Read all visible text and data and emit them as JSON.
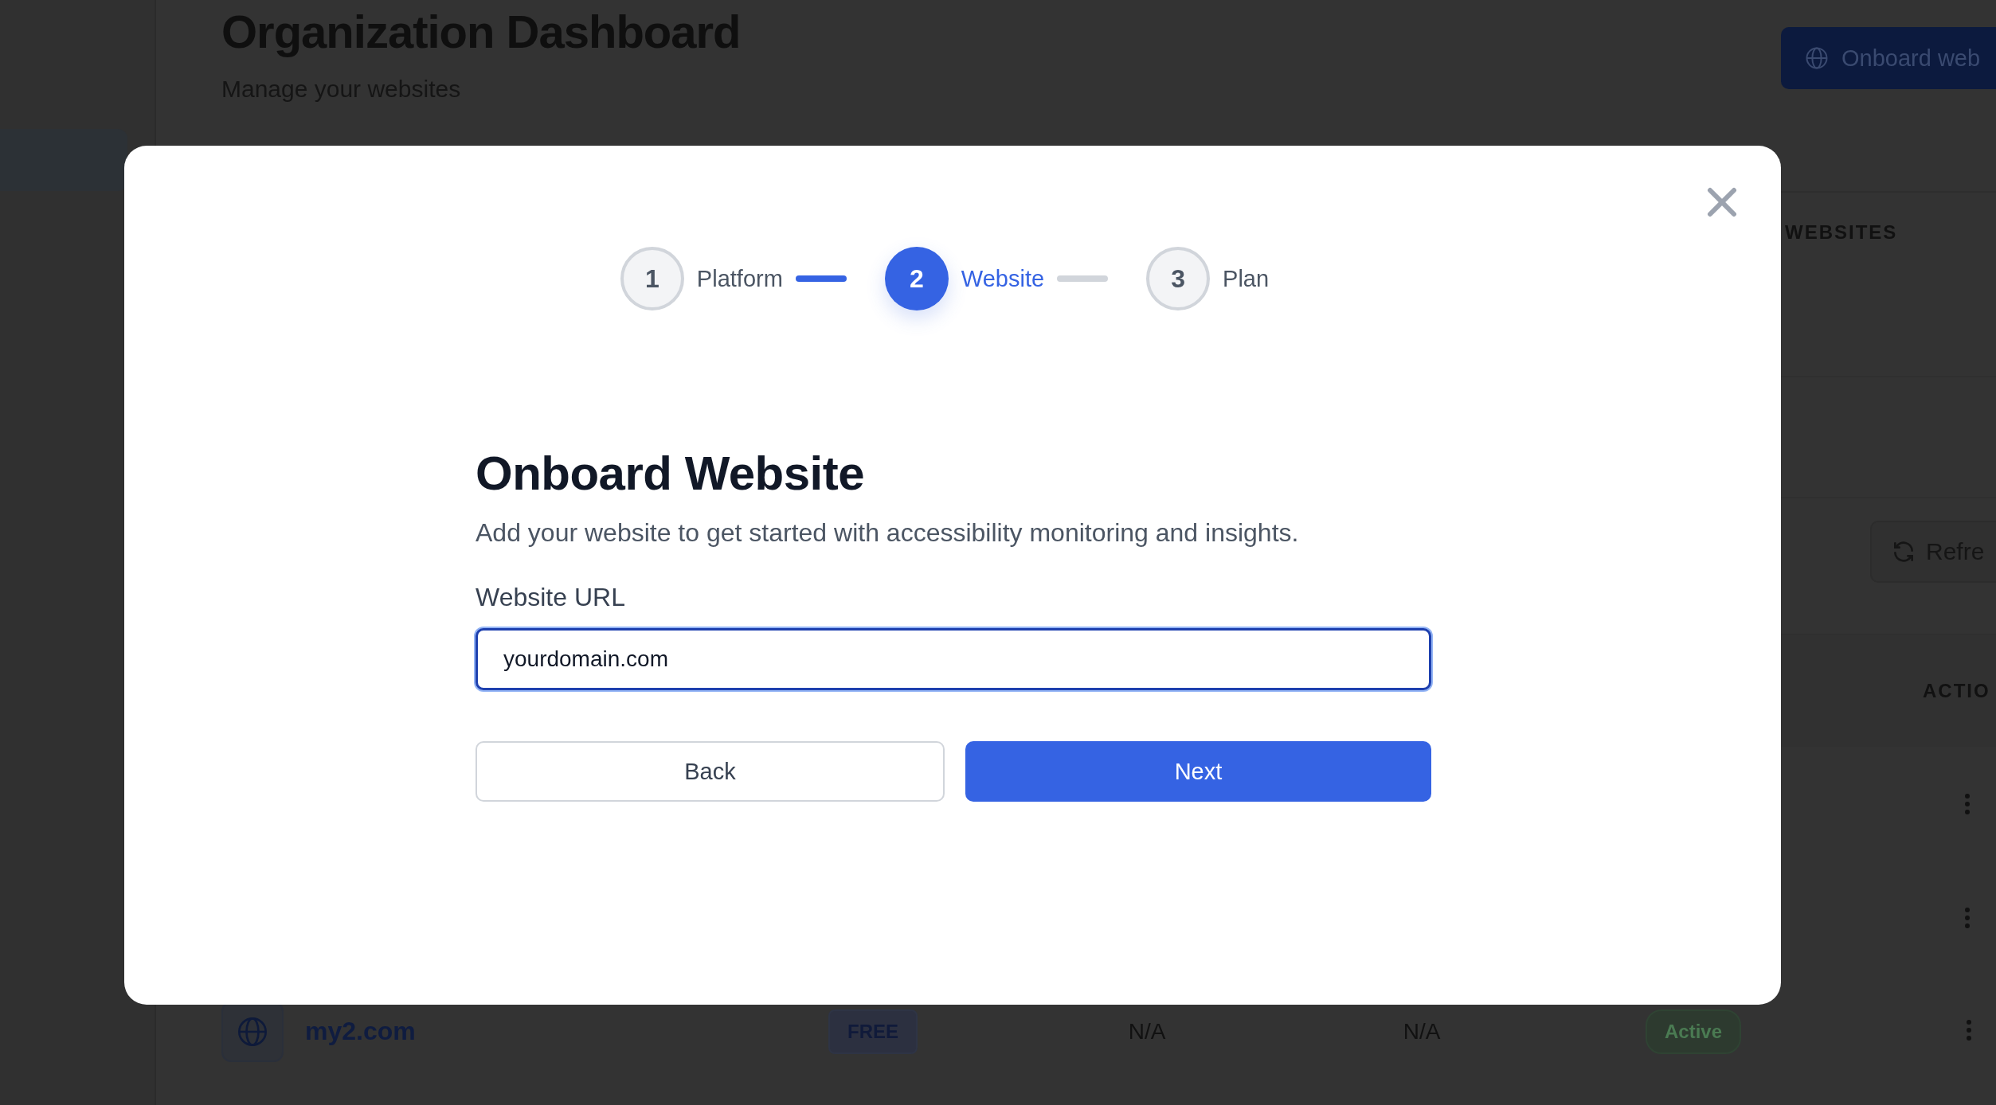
{
  "page": {
    "title": "Organization Dashboard",
    "subtitle": "Manage your websites",
    "onboard_button": "Onboard web",
    "stat_label": "WEBSITES",
    "refresh_button": "Refre",
    "actions_header": "ACTIO",
    "rows": [
      {
        "name": "my2.com",
        "plan": "FREE",
        "column_3": "N/A",
        "column_4": "N/A",
        "status": "Active"
      }
    ]
  },
  "modal": {
    "steps": [
      {
        "number": "1",
        "label": "Platform",
        "selected": false
      },
      {
        "number": "2",
        "label": "Website",
        "selected": true
      },
      {
        "number": "3",
        "label": "Plan",
        "selected": false
      }
    ],
    "title": "Onboard Website",
    "description": "Add your website to get started with accessibility monitoring and insights.",
    "field": {
      "label": "Website URL",
      "value": "yourdomain.com",
      "focused": true
    },
    "buttons": [
      {
        "label": "Back",
        "kind": "secondary"
      },
      {
        "label": "Next",
        "kind": "primary"
      }
    ]
  }
}
